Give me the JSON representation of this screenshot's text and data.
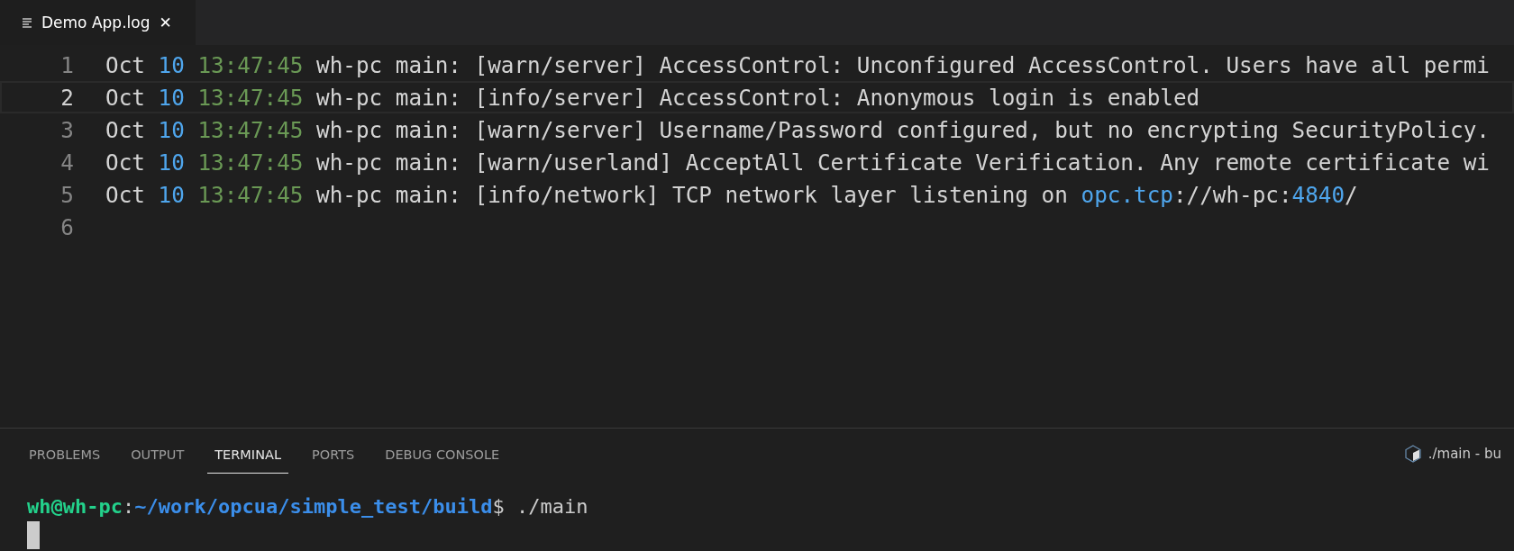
{
  "editor_tab": {
    "title": "Demo App.log",
    "close": "✕"
  },
  "log_lines": [
    {
      "number": "1",
      "current": false,
      "segments": [
        {
          "kind": "plain",
          "text": "Oct "
        },
        {
          "kind": "number",
          "text": "10"
        },
        {
          "kind": "time",
          "text": " 13:47:45"
        },
        {
          "kind": "plain",
          "text": " wh-pc main: [warn/server] AccessControl: Unconfigured AccessControl. Users have all permi"
        }
      ]
    },
    {
      "number": "2",
      "current": true,
      "segments": [
        {
          "kind": "plain",
          "text": "Oct "
        },
        {
          "kind": "number",
          "text": "10"
        },
        {
          "kind": "time",
          "text": " 13:47:45"
        },
        {
          "kind": "plain",
          "text": " wh-pc main: [info/server] AccessControl: Anonymous login is enabled"
        }
      ]
    },
    {
      "number": "3",
      "current": false,
      "segments": [
        {
          "kind": "plain",
          "text": "Oct "
        },
        {
          "kind": "number",
          "text": "10"
        },
        {
          "kind": "time",
          "text": " 13:47:45"
        },
        {
          "kind": "plain",
          "text": " wh-pc main: [warn/server] Username/Password configured, but no encrypting SecurityPolicy."
        }
      ]
    },
    {
      "number": "4",
      "current": false,
      "segments": [
        {
          "kind": "plain",
          "text": "Oct "
        },
        {
          "kind": "number",
          "text": "10"
        },
        {
          "kind": "time",
          "text": " 13:47:45"
        },
        {
          "kind": "plain",
          "text": " wh-pc main: [warn/userland] AcceptAll Certificate Verification. Any remote certificate wi"
        }
      ]
    },
    {
      "number": "5",
      "current": false,
      "segments": [
        {
          "kind": "plain",
          "text": "Oct "
        },
        {
          "kind": "number",
          "text": "10"
        },
        {
          "kind": "time",
          "text": " 13:47:45"
        },
        {
          "kind": "plain",
          "text": " wh-pc main: [info/network] TCP network layer listening on "
        },
        {
          "kind": "number",
          "text": "opc.tcp"
        },
        {
          "kind": "plain",
          "text": "://wh-pc:"
        },
        {
          "kind": "number",
          "text": "4840"
        },
        {
          "kind": "plain",
          "text": "/"
        }
      ]
    },
    {
      "number": "6",
      "current": false
    }
  ],
  "panel_tabs": [
    {
      "label": "PROBLEMS",
      "selected": false
    },
    {
      "label": "OUTPUT",
      "selected": false
    },
    {
      "label": "TERMINAL",
      "selected": true
    },
    {
      "label": "PORTS",
      "selected": false
    },
    {
      "label": "DEBUG CONSOLE",
      "selected": false
    }
  ],
  "terminal_instance": {
    "label": "./main - bu"
  },
  "terminal": {
    "user_host": "wh@wh-pc",
    "separator": ":",
    "path": "~/work/opcua/simple_test/build",
    "command": "$ ./main"
  }
}
